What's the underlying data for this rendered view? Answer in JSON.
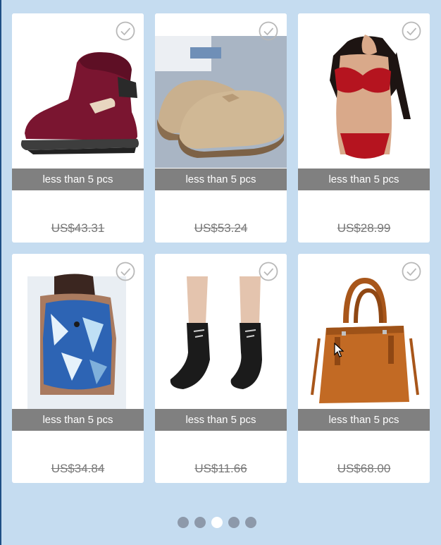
{
  "products": [
    {
      "stock_label": "less than 5 pcs",
      "price": "US$43.31",
      "icon": "red-boot-image"
    },
    {
      "stock_label": "less than 5 pcs",
      "price": "US$53.24",
      "icon": "beige-oxford-shoes-image"
    },
    {
      "stock_label": "less than 5 pcs",
      "price": "US$28.99",
      "icon": "red-lingerie-image"
    },
    {
      "stock_label": "less than 5 pcs",
      "price": "US$34.84",
      "icon": "blue-swimsuit-image"
    },
    {
      "stock_label": "less than 5 pcs",
      "price": "US$11.66",
      "icon": "black-socks-image"
    },
    {
      "stock_label": "less than 5 pcs",
      "price": "US$68.00",
      "icon": "brown-handbag-image"
    }
  ],
  "pagination": {
    "pages": 5,
    "active_index": 2
  },
  "colors": {
    "background": "#c5dcf0",
    "stock_bar": "#808080",
    "dot": "#8d99aa",
    "dot_active": "#ffffff"
  }
}
